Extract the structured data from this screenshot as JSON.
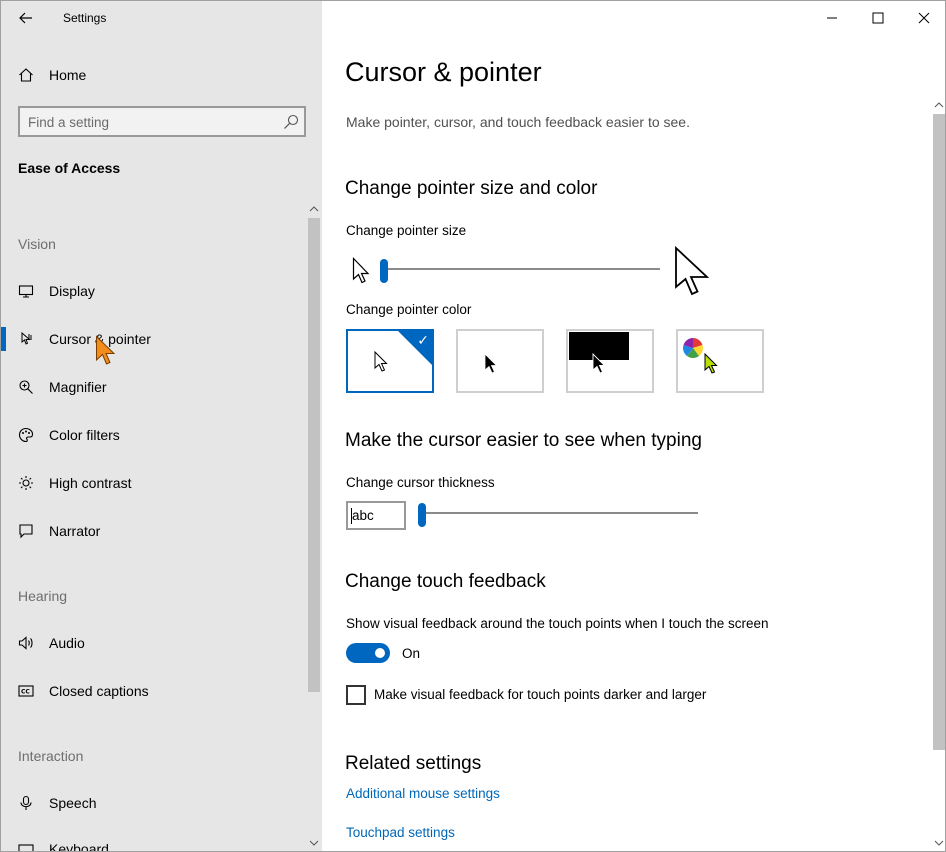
{
  "window": {
    "app_title": "Settings"
  },
  "sidebar": {
    "home_label": "Home",
    "search_placeholder": "Find a setting",
    "section_title": "Ease of Access",
    "groups": {
      "vision": "Vision",
      "hearing": "Hearing",
      "interaction": "Interaction"
    },
    "items": {
      "display": "Display",
      "cursor_pointer": "Cursor & pointer",
      "magnifier": "Magnifier",
      "color_filters": "Color filters",
      "high_contrast": "High contrast",
      "narrator": "Narrator",
      "audio": "Audio",
      "closed_captions": "Closed captions",
      "speech": "Speech",
      "keyboard": "Keyboard"
    },
    "selected_item": "cursor_pointer"
  },
  "main": {
    "title": "Cursor & pointer",
    "description": "Make pointer, cursor, and touch feedback easier to see.",
    "pointer_section": {
      "heading": "Change pointer size and color",
      "size_label": "Change pointer size",
      "size_value": 1,
      "size_range": [
        1,
        15
      ],
      "color_label": "Change pointer color",
      "color_options": [
        "white",
        "black",
        "inverted",
        "custom"
      ],
      "selected_color": "white"
    },
    "cursor_section": {
      "heading": "Make the cursor easier to see when typing",
      "thickness_label": "Change cursor thickness",
      "preview_text": "abc",
      "thickness_value": 1,
      "thickness_range": [
        1,
        20
      ]
    },
    "touch_section": {
      "heading": "Change touch feedback",
      "toggle_label": "Show visual feedback around the touch points when I touch the screen",
      "toggle_state": "On",
      "checkbox_label": "Make visual feedback for touch points darker and larger",
      "checkbox_checked": false
    },
    "related": {
      "heading": "Related settings",
      "links": {
        "mouse": "Additional mouse settings",
        "touchpad": "Touchpad settings"
      }
    }
  },
  "colors": {
    "accent": "#0067c0",
    "link": "#0067b8",
    "sidebar_bg": "#e6e6e6"
  }
}
